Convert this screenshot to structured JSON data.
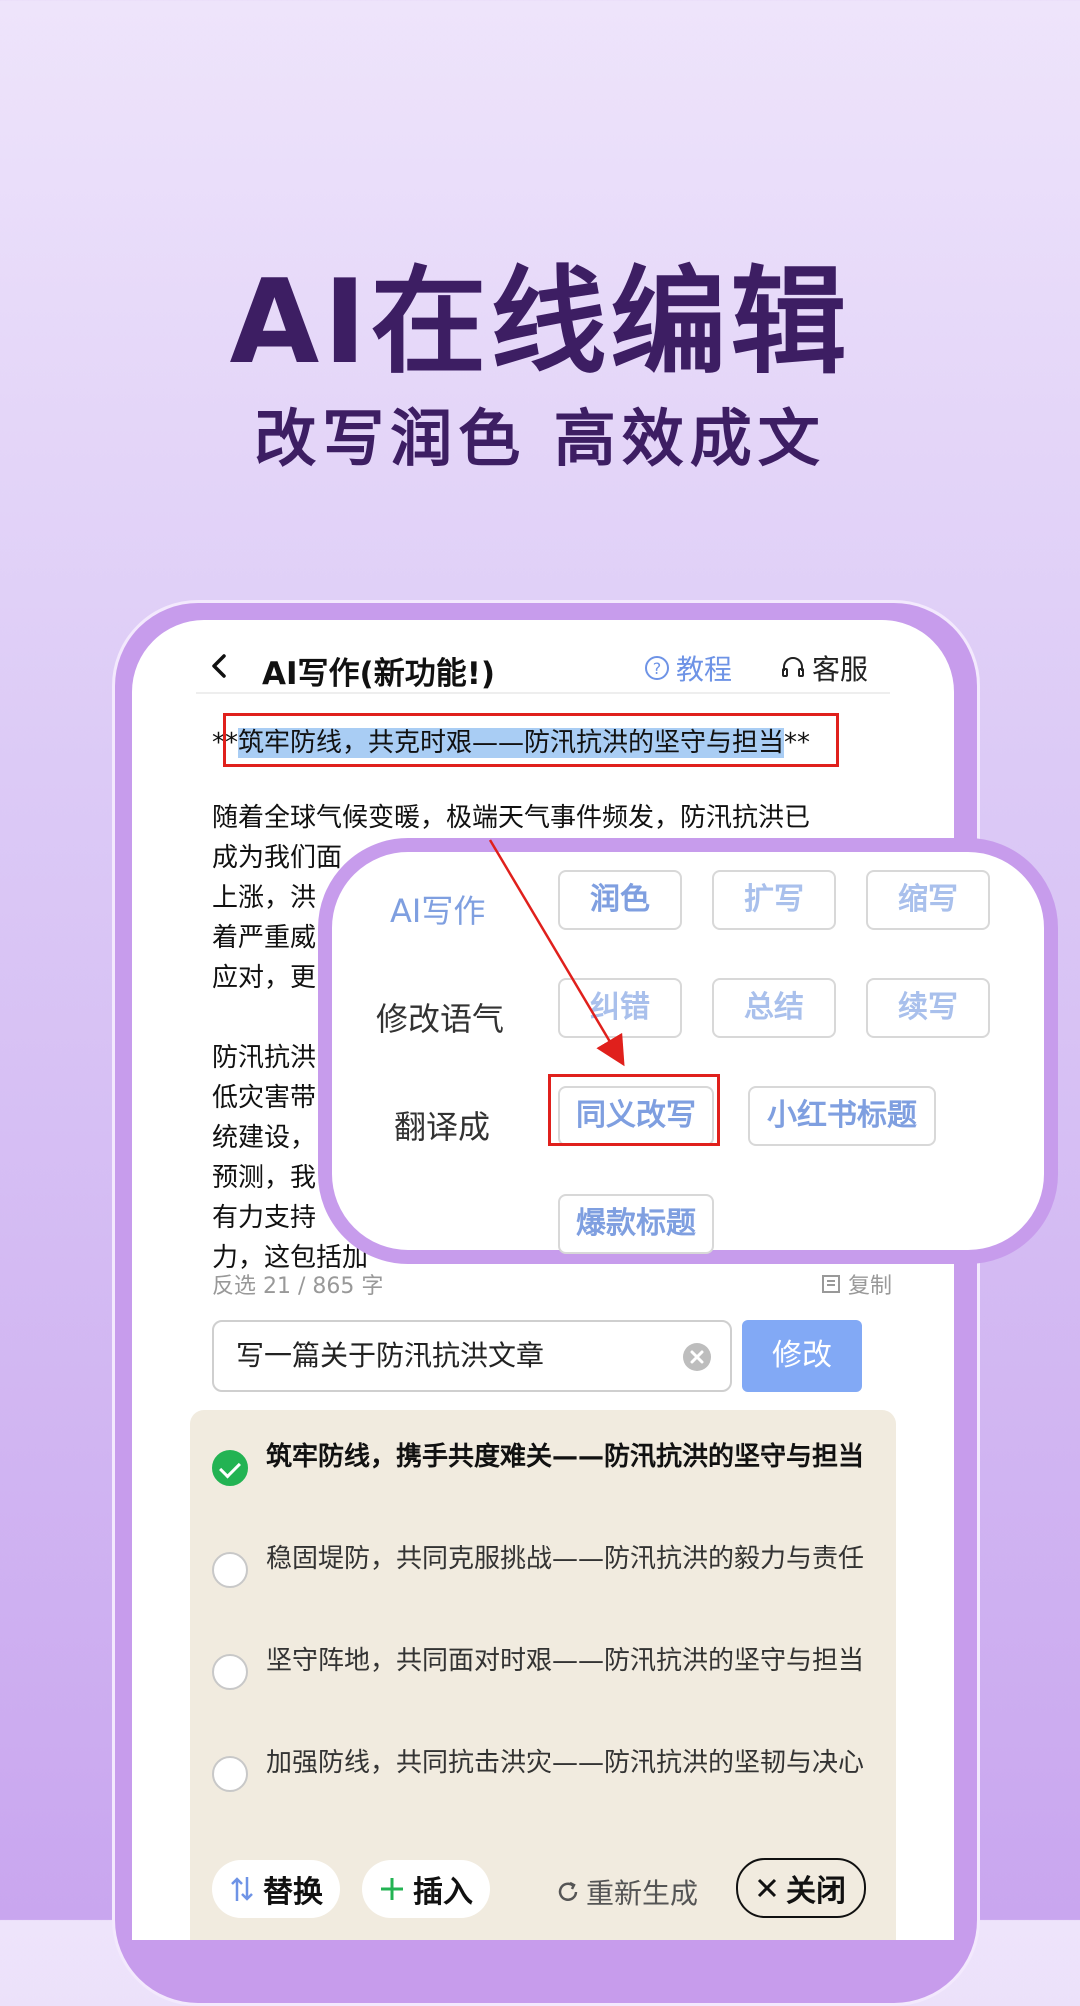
{
  "hero": {
    "title": "AI在线编辑",
    "subtitle": "改写润色  高效成文"
  },
  "topbar": {
    "title": "AI写作(新功能!)",
    "tutorial": "教程",
    "service": "客服"
  },
  "document": {
    "headline_prefix": "**",
    "headline": "筑牢防线，共克时艰——防汛抗洪的坚守与担当",
    "headline_suffix": "**",
    "paragraph1_lines": [
      "随着全球气候变暖，极端天气事件频发，防汛抗洪已",
      "成为我们面",
      "上涨，洪",
      "着严重威",
      "应对，更"
    ],
    "paragraph2_lines": [
      "防汛抗洪",
      "低灾害带",
      "统建设，",
      "预测，我",
      "有力支持",
      "力，这包括加"
    ]
  },
  "status": {
    "counter": "反选 21 / 865 字",
    "copy": "复制"
  },
  "prompt": {
    "value": "写一篇关于防汛抗洪文章",
    "submit": "修改"
  },
  "results": [
    {
      "text": "筑牢防线，携手共度难关——防汛抗洪的坚守与担当",
      "selected": true
    },
    {
      "text": "稳固堤防，共同克服挑战——防汛抗洪的毅力与责任",
      "selected": false
    },
    {
      "text": "坚守阵地，共同面对时艰——防汛抗洪的坚守与担当",
      "selected": false
    },
    {
      "text": "加强防线，共同抗击洪灾——防汛抗洪的坚韧与决心",
      "selected": false
    }
  ],
  "actions": {
    "replace": "替换",
    "insert": "插入",
    "regenerate": "重新生成",
    "close": "关闭"
  },
  "popup": {
    "rows": [
      {
        "label": "AI写作",
        "chips": [
          "润色",
          "扩写",
          "缩写"
        ]
      },
      {
        "label": "修改语气",
        "chips": [
          "纠错",
          "总结",
          "续写"
        ]
      },
      {
        "label": "翻译成",
        "chips": [
          "同义改写",
          "小红书标题"
        ]
      },
      {
        "label": "",
        "chips": [
          "爆款标题"
        ]
      }
    ],
    "selected_chip": "同义改写"
  },
  "colors": {
    "accent_blue": "#7f9fe0",
    "highlight_red": "#e0201c",
    "check_green": "#23b353",
    "hero_text": "#3d1e63"
  }
}
